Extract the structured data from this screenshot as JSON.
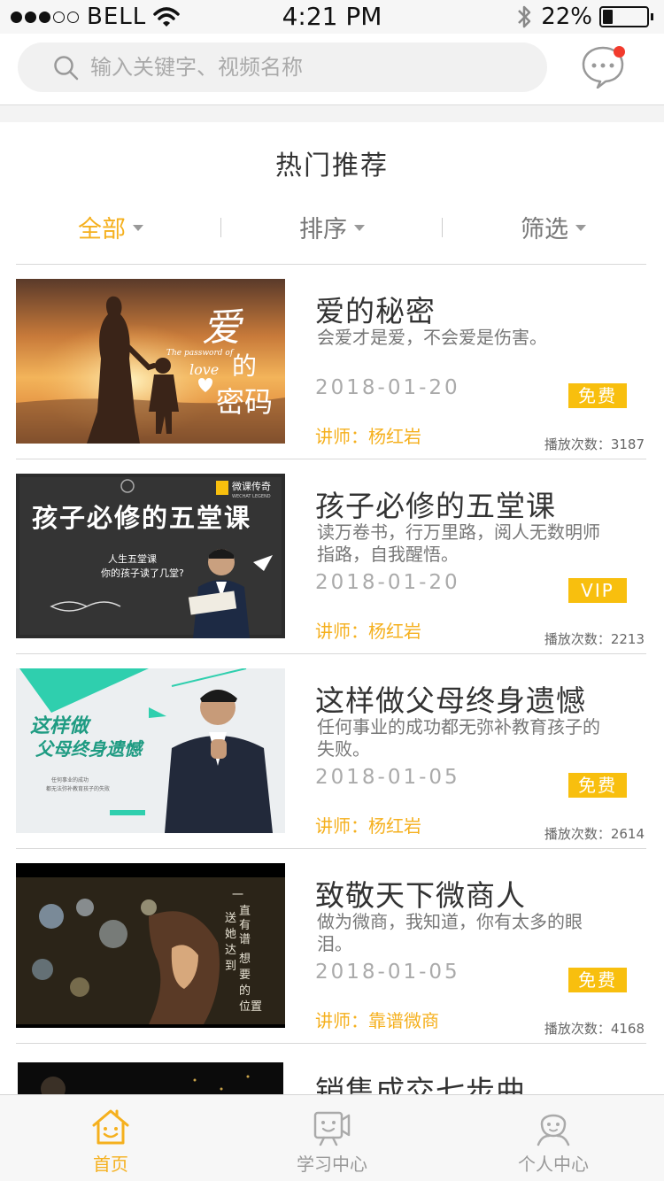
{
  "status_bar": {
    "carrier": "BELL",
    "time": "4:21 PM",
    "battery_percent": "22%",
    "battery_level": 0.22,
    "signal_filled": 3,
    "signal_total": 5
  },
  "header": {
    "search_placeholder": "输入关键字、视频名称",
    "has_unread_message": true
  },
  "section": {
    "title": "热门推荐"
  },
  "filters": [
    {
      "label": "全部",
      "active": true
    },
    {
      "label": "排序",
      "active": false
    },
    {
      "label": "筛选",
      "active": false
    }
  ],
  "courses": [
    {
      "title": "爱的秘密",
      "description": "会爱才是爱，不会爱是伤害。",
      "date": "2018-01-20",
      "badge": "免费",
      "teacher": "讲师：杨红岩",
      "plays": "播放次数：3187",
      "thumb_text": "爱的密码",
      "thumb_subtext": "The password of love"
    },
    {
      "title": "孩子必修的五堂课",
      "description": "读万卷书，行万里路，阅人无数明师指路，自我醒悟。",
      "date": "2018-01-20",
      "badge": "VIP",
      "teacher": "讲师：杨红岩",
      "plays": "播放次数：2213",
      "thumb_text": "孩子必修的五堂课",
      "thumb_subtext": "人生五堂课 你的孩子读了几堂?",
      "thumb_brand": "微课传奇",
      "thumb_brand_en": "WECHAT LEGEND"
    },
    {
      "title": "这样做父母终身遗憾",
      "description": "任何事业的成功都无弥补教育孩子的失败。",
      "date": "2018-01-05",
      "badge": "免费",
      "teacher": "讲师：杨红岩",
      "plays": "播放次数：2614",
      "thumb_text_1": "这样做",
      "thumb_text_2": "父母终身遗憾",
      "thumb_subtext": "任何事业的成功 都无法弥补教育孩子的失败"
    },
    {
      "title": "致敬天下微商人",
      "description": "做为微商，我知道，你有太多的眼泪。",
      "date": "2018-01-05",
      "badge": "免费",
      "teacher": "讲师：靠谱微商",
      "plays": "播放次数：4168",
      "thumb_text": "一直有谱微商 送她达到想要的位置"
    },
    {
      "title": "销售成交七步曲"
    }
  ],
  "tabbar": [
    {
      "label": "首页",
      "icon": "home-icon",
      "active": true
    },
    {
      "label": "学习中心",
      "icon": "video-camera-icon",
      "active": false
    },
    {
      "label": "个人中心",
      "icon": "user-icon",
      "active": false
    }
  ],
  "colors": {
    "accent": "#f5b01e",
    "badge": "#f8bf0e",
    "notification": "#f23b2d",
    "text_primary": "#333333",
    "text_secondary": "#777777"
  }
}
